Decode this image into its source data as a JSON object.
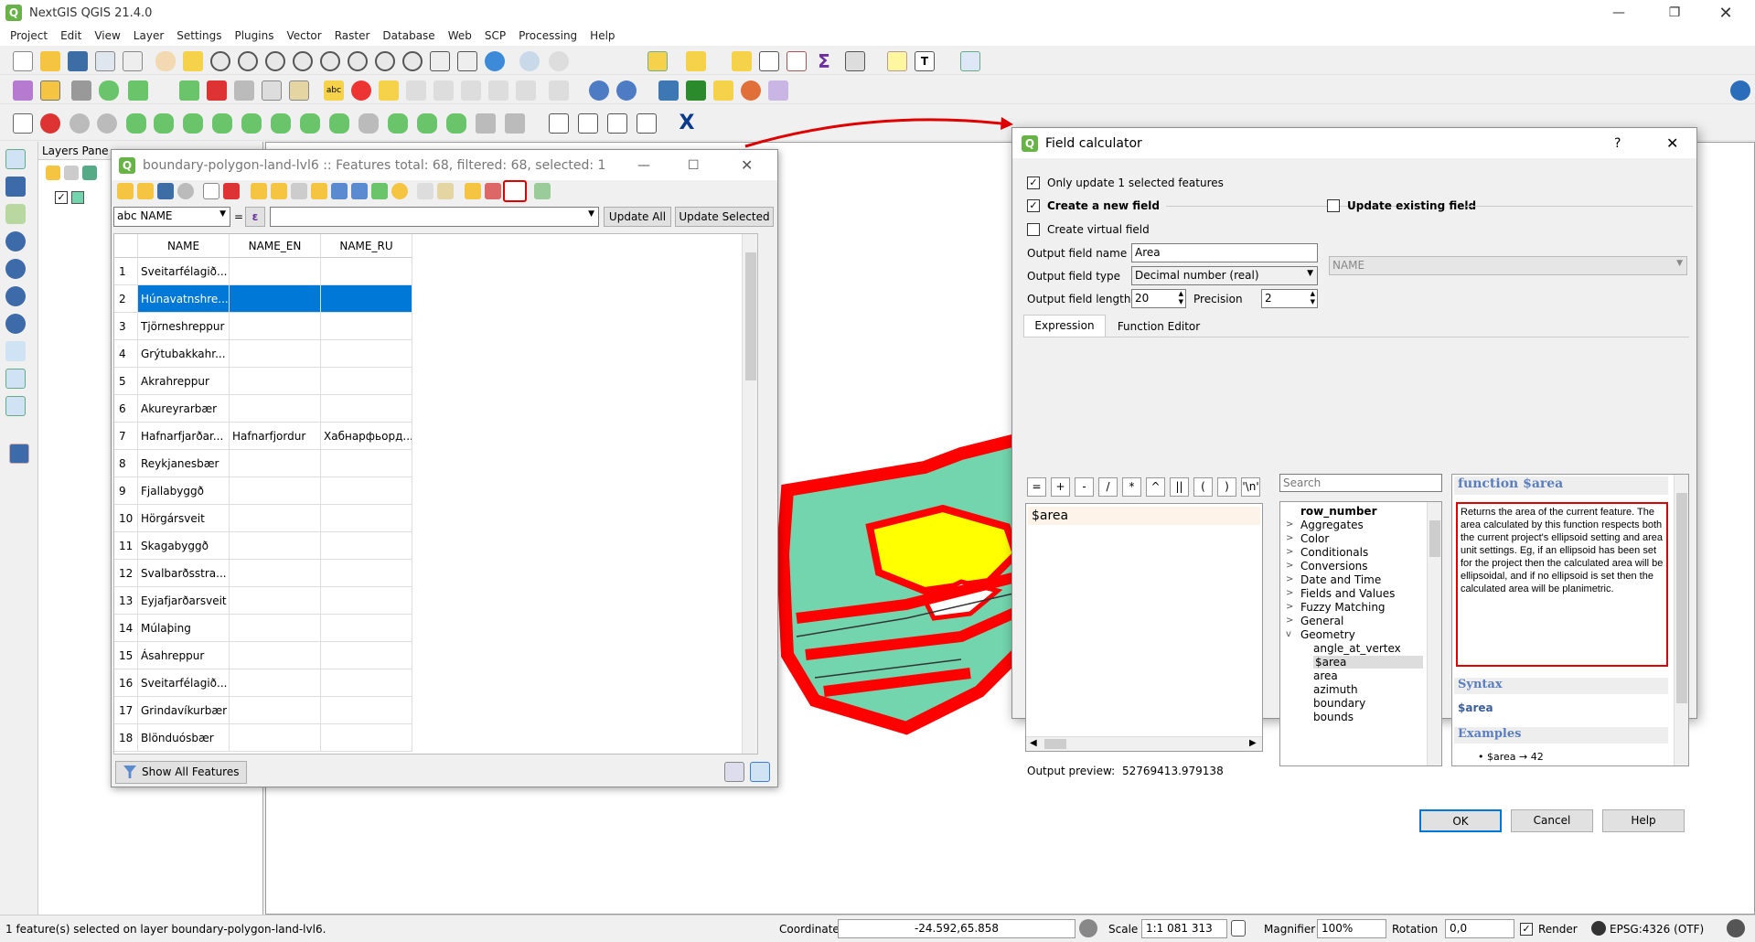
{
  "app": {
    "title": "NextGIS QGIS 21.4.0",
    "menu": [
      "Project",
      "Edit",
      "View",
      "Layer",
      "Settings",
      "Plugins",
      "Vector",
      "Raster",
      "Database",
      "Web",
      "SCP",
      "Processing",
      "Help"
    ]
  },
  "layers_panel": {
    "title": "Layers Pane"
  },
  "attribute_table": {
    "title": "boundary-polygon-land-lvl6 :: Features total: 68, filtered: 68, selected: 1",
    "field_select": "abc NAME",
    "equals": "=",
    "epsilon": "ε",
    "update_all": "Update All",
    "update_selected": "Update Selected",
    "columns": [
      "NAME",
      "NAME_EN",
      "NAME_RU"
    ],
    "rows": [
      {
        "n": "1",
        "name": "Sveitarfélagið...",
        "en": "",
        "ru": ""
      },
      {
        "n": "2",
        "name": "Húnavatnshre...",
        "en": "",
        "ru": ""
      },
      {
        "n": "3",
        "name": "Tjörneshreppur",
        "en": "",
        "ru": ""
      },
      {
        "n": "4",
        "name": "Grýtubakkahr...",
        "en": "",
        "ru": ""
      },
      {
        "n": "5",
        "name": "Akrahreppur",
        "en": "",
        "ru": ""
      },
      {
        "n": "6",
        "name": "Akureyrarbær",
        "en": "",
        "ru": ""
      },
      {
        "n": "7",
        "name": "Hafnarfjarðar...",
        "en": "Hafnarfjordur",
        "ru": "Хабнарфьорд..."
      },
      {
        "n": "8",
        "name": "Reykjanesbær",
        "en": "",
        "ru": ""
      },
      {
        "n": "9",
        "name": "Fjallabyggð",
        "en": "",
        "ru": ""
      },
      {
        "n": "10",
        "name": "Hörgársveit",
        "en": "",
        "ru": ""
      },
      {
        "n": "11",
        "name": "Skagabyggð",
        "en": "",
        "ru": ""
      },
      {
        "n": "12",
        "name": "Svalbarðsstra...",
        "en": "",
        "ru": ""
      },
      {
        "n": "13",
        "name": "Eyjafjarðarsveit",
        "en": "",
        "ru": ""
      },
      {
        "n": "14",
        "name": "Múlaþing",
        "en": "",
        "ru": ""
      },
      {
        "n": "15",
        "name": "Ásahreppur",
        "en": "",
        "ru": ""
      },
      {
        "n": "16",
        "name": "Sveitarfélagið...",
        "en": "",
        "ru": ""
      },
      {
        "n": "17",
        "name": "Grindavíkurbær",
        "en": "",
        "ru": ""
      },
      {
        "n": "18",
        "name": "Blönduósbær",
        "en": "",
        "ru": ""
      }
    ],
    "selected_row": "2",
    "show_all": "Show All Features"
  },
  "field_calculator": {
    "title": "Field calculator",
    "help_glyph": "?",
    "only_update": "Only update 1 selected features",
    "create_new": "Create a new field",
    "update_existing": "Update existing field",
    "create_virtual": "Create virtual field",
    "output_name_label": "Output field name",
    "output_name_value": "Area",
    "output_type_label": "Output field type",
    "output_type_value": "Decimal number (real)",
    "output_length_label": "Output field length",
    "output_length_value": "20",
    "precision_label": "Precision",
    "precision_value": "2",
    "existing_field_value": "NAME",
    "tab_expression": "Expression",
    "tab_function_editor": "Function Editor",
    "operators": [
      "=",
      "+",
      "-",
      "/",
      "*",
      "^",
      "||",
      "(",
      ")",
      "'\\n'"
    ],
    "expression": "$area",
    "output_preview_label": "Output preview:",
    "output_preview_value": "52769413.979138",
    "search_placeholder": "Search",
    "tree": [
      {
        "label": "row_number",
        "bold": true,
        "arrow": ""
      },
      {
        "label": "Aggregates",
        "arrow": ">"
      },
      {
        "label": "Color",
        "arrow": ">"
      },
      {
        "label": "Conditionals",
        "arrow": ">"
      },
      {
        "label": "Conversions",
        "arrow": ">"
      },
      {
        "label": "Date and Time",
        "arrow": ">"
      },
      {
        "label": "Fields and Values",
        "arrow": ">"
      },
      {
        "label": "Fuzzy Matching",
        "arrow": ">"
      },
      {
        "label": "General",
        "arrow": ">"
      },
      {
        "label": "Geometry",
        "arrow": "v"
      }
    ],
    "tree_children": [
      "angle_at_vertex",
      "$area",
      "area",
      "azimuth",
      "boundary",
      "bounds"
    ],
    "tree_selected_child": "$area",
    "help_title": "function $area",
    "help_text": "Returns the area of the current feature. The area calculated by this function respects both the current project's ellipsoid setting and area unit settings. Eg, if an ellipsoid has been set for the project then the calculated area will be ellipsoidal, and if no ellipsoid is set then the calculated area will be planimetric.",
    "syntax_heading": "Syntax",
    "syntax_value": "$area",
    "examples_heading": "Examples",
    "example_value": "• $area → 42",
    "ok": "OK",
    "cancel": "Cancel",
    "help": "Help"
  },
  "status": {
    "message": "1 feature(s) selected on layer boundary-polygon-land-lvl6.",
    "coordinate_label": "Coordinate",
    "coordinate_value": "-24.592,65.858",
    "scale_label": "Scale",
    "scale_value": "1:1 081 313",
    "magnifier_label": "Magnifier",
    "magnifier_value": "100%",
    "rotation_label": "Rotation",
    "rotation_value": "0,0",
    "render_label": "Render",
    "crs": "EPSG:4326 (OTF)"
  },
  "colors": {
    "accent_selection": "#0078d7",
    "highlight_red": "#e00000",
    "map_teal": "#72d5ad",
    "map_yellow": "#ffff00",
    "map_red": "#ff0000"
  }
}
